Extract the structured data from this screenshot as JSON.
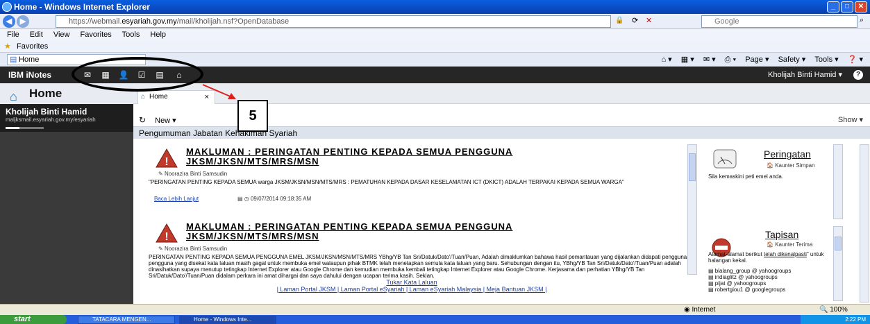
{
  "window": {
    "title": "Home - Windows Internet Explorer"
  },
  "address": {
    "url_prefix": "https://webmail.",
    "url_domain": "esyariah.gov.my",
    "url_path": "/mail/kholijah.nsf?OpenDatabase",
    "search_placeholder": "Google"
  },
  "menu": [
    "File",
    "Edit",
    "View",
    "Favorites",
    "Tools",
    "Help"
  ],
  "favorites": {
    "label": "Favorites"
  },
  "ie_tab": {
    "label": "Home"
  },
  "ie_tools": [
    "Page ▾",
    "Safety ▾",
    "Tools ▾"
  ],
  "inotes": {
    "brand": "IBM iNotes",
    "user": "Kholijah Binti Hamid ▾"
  },
  "left": {
    "home": "Home",
    "user_name": "Kholijah Binti Hamid",
    "user_email": "maljksmail.esyariah.gov.my/esyariah"
  },
  "main": {
    "tab_label": "Home",
    "new_label": "New ▾",
    "show_label": "Show ▾",
    "section_title": "Pengumuman Jabatan Kehakiman Syariah",
    "announcements": [
      {
        "title": "MAKLUMAN : PERINGATAN PENTING KEPADA SEMUA PENGGUNA JKSM/JKSN/MTS/MRS/MSN",
        "author": "Noorazira Binti Samsudin",
        "body": "\"PERINGATAN PENTING KEPADA SEMUA warga JKSM/JKSN/MSN/MTS/MRS : PEMATUHAN KEPADA DASAR KESELAMATAN ICT (DKICT) ADALAH TERPAKAI KEPADA SEMUA WARGA\"",
        "link": "Baca Lebih Lanjut",
        "date": "09/07/2014 09:18:35 AM"
      },
      {
        "title": "MAKLUMAN : PERINGATAN PENTING KEPADA SEMUA PENGGUNA JKSM/JKSN/MTS/MRS/MSN",
        "author": "Noorazira Binti Samsudin",
        "body": "PERINGATAN PENTING KEPADA SEMUA PENGGUNA EMEL JKSM/JKSN/MSN/MTS/MRS YBhg/YB Tan Sri/Datuk/Dato'/Tuan/Puan,  Adalah dimaklumkan bahawa hasil pemantauan yang dijalankan didapati pengguna-pengguna yang disekat kata laluan masih gagal untuk membuka emel walaupun pihak BTMK telah menetapkan semula kata laluan yang baru.  Sehubungan dengan itu, YBhg/YB Tan Sri/Datuk/Dato'/Tuan/Puan adalah dinasihatkan supaya menutup tetingkap Internet Explorer atau Google Chrome dan kemudian membuka kembali tetingkap Internet Explorer atau Google Chrome.  Kerjasama dan perhatian YBhg/YB Tan Sri/Datuk/Dato'/Tuan/Puan didalam perkara ini amat dihargai dan saya dahului dengan ucapan terima kasih.  Sekian."
      }
    ],
    "footer": {
      "link1": "Tukar Kata Laluan",
      "link2": "| Laman Portal JKSM | Laman Portal eSyariah | Laman eSyariah Malaysia | Meja Bantuan JKSM |"
    }
  },
  "widgets": {
    "peringatan": {
      "title": "Peringatan",
      "sub": "Kaunter Simpan",
      "text": "Sila kemaskini peti emel anda."
    },
    "tapisan": {
      "title": "Tapisan",
      "sub": "Kaunter Terima",
      "text1": "Alamat-alamat berikut ",
      "text_link": "telah dikenalpasti",
      "text2": "\" untuk halangan kekal.",
      "items": [
        "blalang_group @ yahoogroups",
        "indiaglitz @ yahoogroups",
        "pijat @ yahoogroups",
        "robertgiou1 @ googlegroups"
      ]
    }
  },
  "status": {
    "zone": "Internet",
    "zoom": "100%"
  },
  "taskbar": {
    "start": "start",
    "task1": "TATACARA MENGEN...",
    "task2": "Home - Windows Inte...",
    "clock": "2:22 PM"
  },
  "annotation": {
    "number": "5"
  },
  "colors": {
    "inotes_header": "#262626",
    "left_panel": "#3a3a3a",
    "title_bar": "#0a5fe0",
    "taskbar": "#245edb",
    "arrow": "#e02020"
  }
}
